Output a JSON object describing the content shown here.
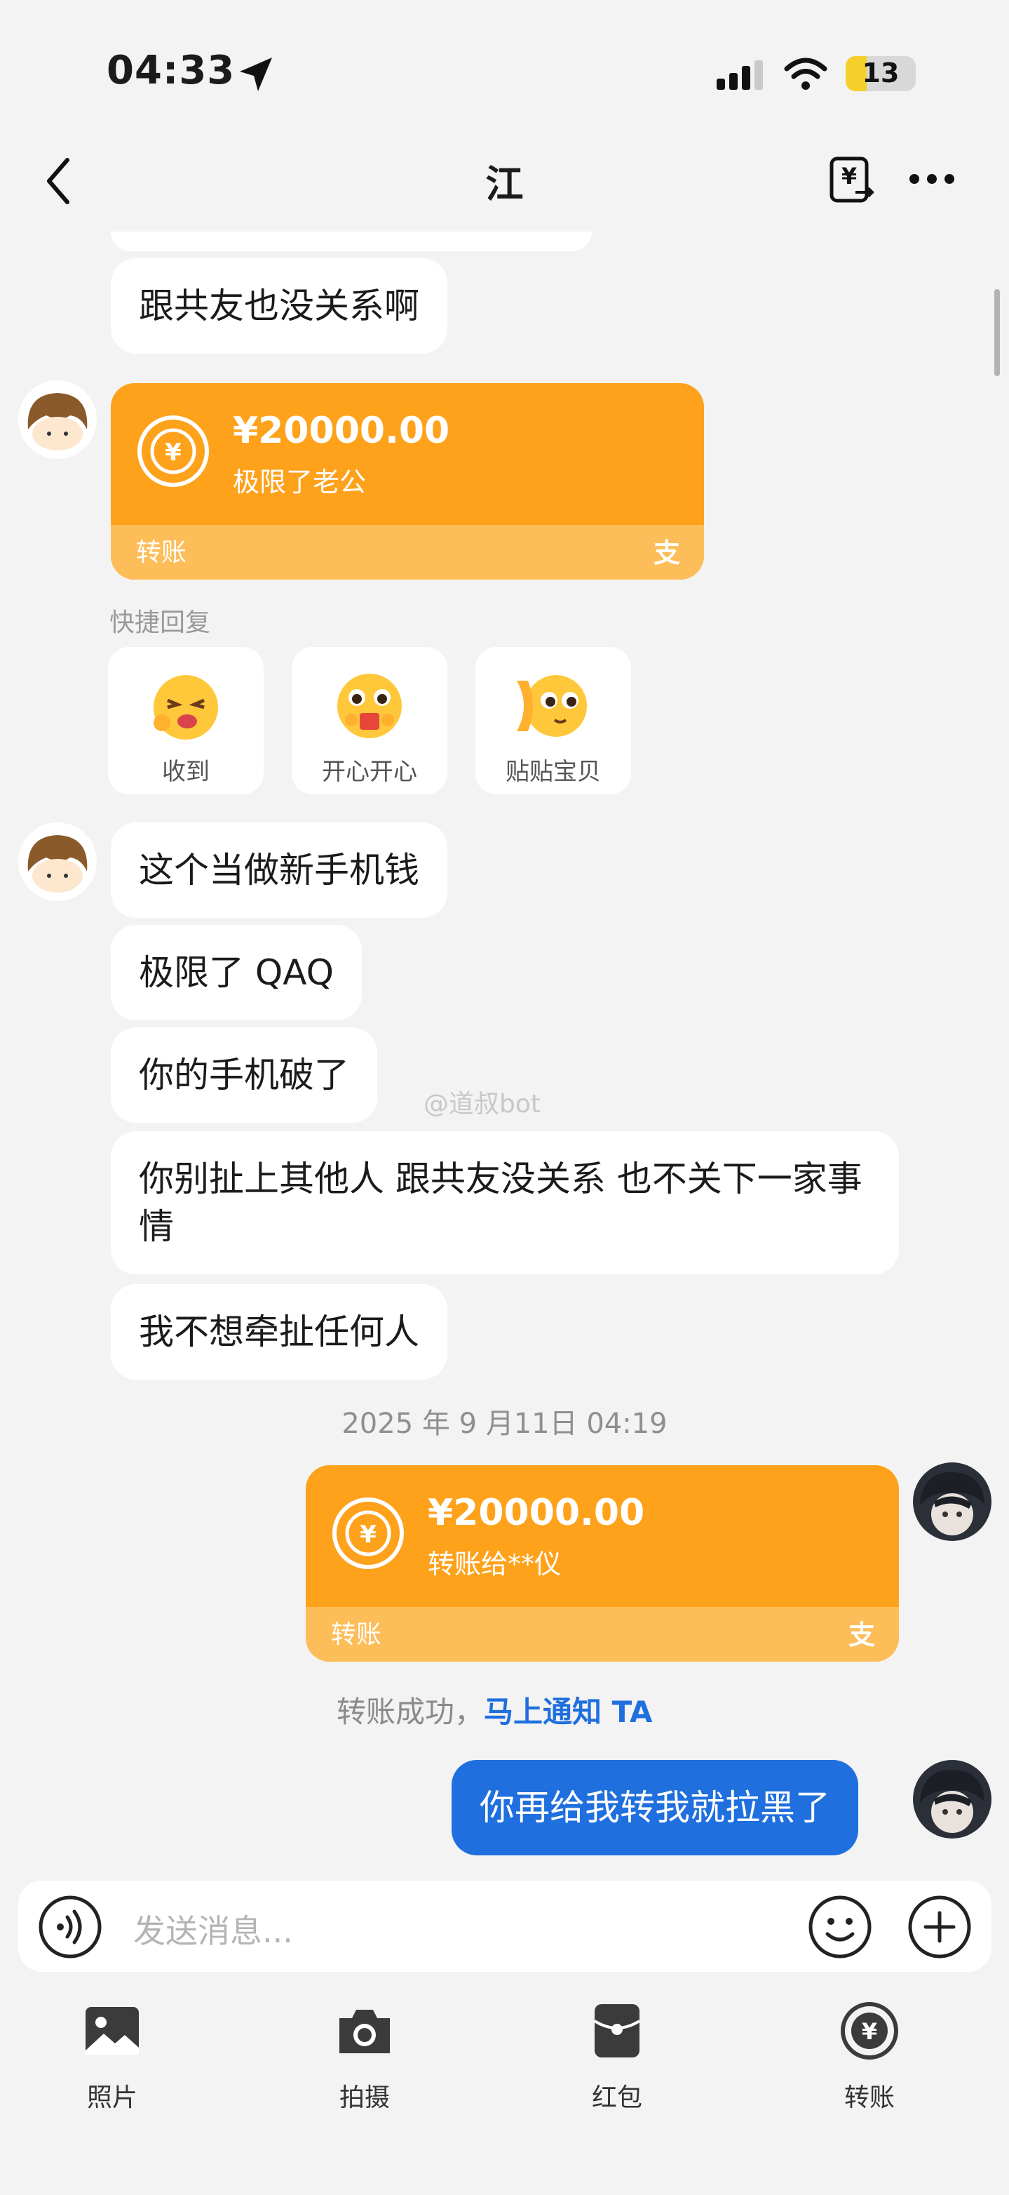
{
  "status_bar": {
    "time": "04:33",
    "battery": "13"
  },
  "header": {
    "title": "江"
  },
  "messages": {
    "m1": "跟共友也没关系啊",
    "m2": "这个当做新手机钱",
    "m3": "极限了 QAQ",
    "m4": "你的手机破了",
    "m5": "你别扯上其他人 跟共友没关系 也不关下一家事情",
    "m6": "我不想牵扯任何人",
    "m7": "你再给我转我就拉黑了"
  },
  "transfer_in": {
    "amount": "¥20000.00",
    "memo": "极限了老公",
    "label": "转账",
    "logo": "支"
  },
  "quick_reply": {
    "label": "快捷回复",
    "items": [
      "收到",
      "开心开心",
      "贴贴宝贝"
    ]
  },
  "watermark": "@道叔bot",
  "timestamp": "2025 年 9 月11日 04:19",
  "transfer_out": {
    "amount": "¥20000.00",
    "memo": "转账给**仪",
    "label": "转账",
    "logo": "支"
  },
  "transfer_status": {
    "text": "转账成功，",
    "link": "马上通知 TA"
  },
  "input": {
    "placeholder": "发送消息..."
  },
  "toolbar": {
    "photo": "照片",
    "camera": "拍摄",
    "red_packet": "红包",
    "transfer": "转账"
  },
  "colors": {
    "orange": "#fea21c",
    "blue": "#1f6fde",
    "background": "#f3f3f3"
  },
  "icons": [
    "location-arrow-icon",
    "signal-icon",
    "wifi-icon",
    "battery-icon",
    "back-icon",
    "transfer-icon",
    "more-icon",
    "coin-icon",
    "voice-icon",
    "emoji-icon",
    "plus-icon",
    "photo-icon",
    "camera-icon",
    "red-packet-icon"
  ]
}
